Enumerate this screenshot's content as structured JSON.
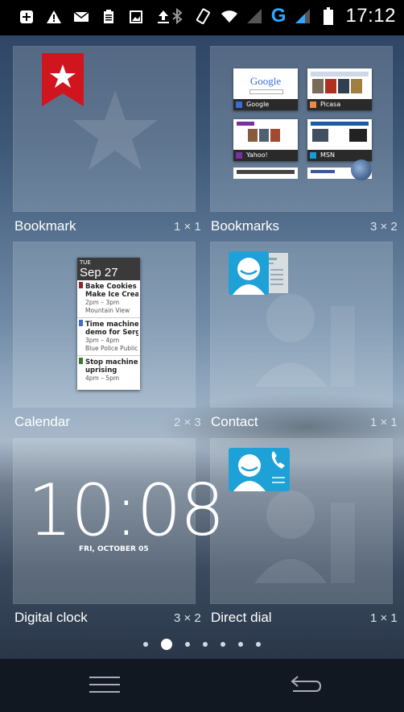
{
  "status_bar": {
    "time": "17:12",
    "network_type": "G",
    "left_icons": [
      "add-icon",
      "warning-icon",
      "mail-icon",
      "clipboard-icon",
      "image-icon",
      "upload-icon"
    ],
    "right_icons": [
      "bluetooth-icon",
      "rotate-icon",
      "wifi-icon",
      "signal-weak-icon",
      "signal-icon",
      "battery-icon"
    ]
  },
  "widgets": [
    {
      "name": "Bookmark",
      "size": "1 × 1"
    },
    {
      "name": "Bookmarks",
      "size": "3 × 2",
      "thumbnails": [
        {
          "label": "Google",
          "logo": "Google"
        },
        {
          "label": "Picasa"
        },
        {
          "label": "Yahoo!"
        },
        {
          "label": "MSN"
        }
      ]
    },
    {
      "name": "Calendar",
      "size": "2 × 3",
      "calendar": {
        "day": "TUE",
        "date": "Sep 27",
        "events": [
          {
            "title1": "Bake Cookies &",
            "title2": "Make Ice Cream",
            "time": "2pm – 3pm",
            "location": "Mountain View",
            "color": "#8b2a2a"
          },
          {
            "title1": "Time machine",
            "title2": "demo for Sergey",
            "time": "3pm – 4pm",
            "location": "Blue Police Public",
            "color": "#3d6fc4"
          },
          {
            "title1": "Stop machine",
            "title2": "uprising",
            "time": "4pm – 5pm",
            "location": "",
            "color": "#3b7a2c"
          }
        ]
      }
    },
    {
      "name": "Contact",
      "size": "1 × 1"
    },
    {
      "name": "Digital clock",
      "size": "3 × 2",
      "clock_time": "10:08",
      "clock_date": "FRI, OCTOBER 05"
    },
    {
      "name": "Direct dial",
      "size": "1 × 1"
    }
  ],
  "pager": {
    "pages": 7,
    "active_index": 1
  },
  "nav": {
    "left_icon": "menu-icon",
    "right_icon": "back-icon"
  },
  "colors": {
    "accent_blue": "#2fa6ff",
    "contact_blue": "#1ea1d6",
    "ribbon_red": "#d0151f"
  }
}
